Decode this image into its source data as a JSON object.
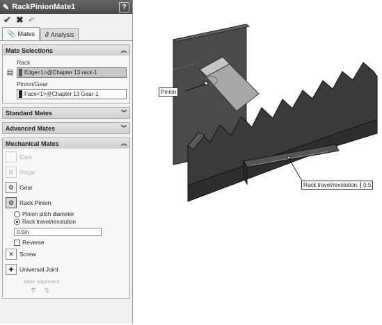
{
  "panel": {
    "title": "RackPinionMate1",
    "help": "?",
    "tabs": [
      {
        "label": "Mates",
        "icon": "paperclip-icon"
      },
      {
        "label": "Analysis",
        "icon": "analysis-icon"
      }
    ],
    "mate_selections": {
      "header": "Mate Selections",
      "rack_label": "Rack",
      "rack_value": "Edge<1>@Chapter 13 rack-1",
      "pinion_label": "Pinion/Gear",
      "pinion_value": "Face<1>@Chapter 13 Gear-1"
    },
    "standard_mates": {
      "header": "Standard Mates"
    },
    "advanced_mates": {
      "header": "Advanced Mates"
    },
    "mechanical_mates": {
      "header": "Mechanical Mates",
      "items": {
        "cam": "Cam",
        "hinge": "Hinge",
        "gear": "Gear",
        "rack_pinion": "Rack Pinion",
        "screw": "Screw",
        "universal_joint": "Universal Joint"
      },
      "radio_pitch": "Pinion pitch diameter",
      "radio_travel": "Rack travel/revolution",
      "selected_option": "Rack travel/revolution",
      "value": "0.5in",
      "reverse": "Reverse",
      "reverse_checked": false,
      "mate_alignment": "Mate alignment:"
    }
  },
  "viewport": {
    "pinion_callout": "Pinion",
    "rack_callout_label": "Rack travel/revolution:",
    "rack_callout_value": "0.5"
  },
  "colors": {
    "title_bar": "#555555",
    "rack": "#3a3a3a",
    "plate": "#4a4a4a",
    "pinion": "#a8a8a8"
  }
}
